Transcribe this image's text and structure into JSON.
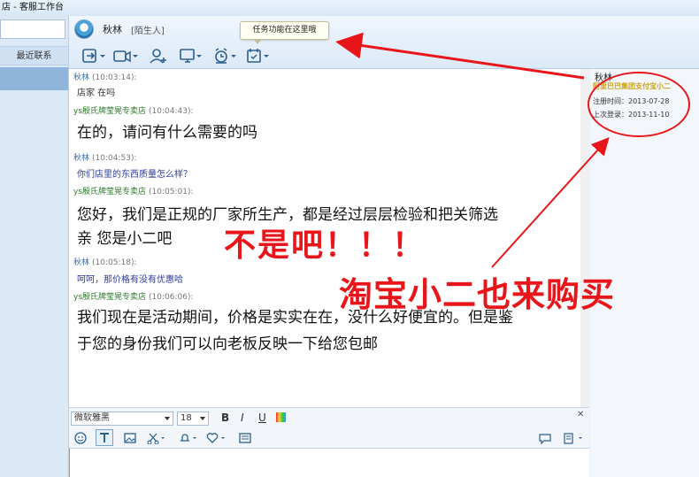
{
  "window": {
    "title": "店 - 客服工作台"
  },
  "left_panel": {
    "recent_label": "最近联系"
  },
  "header": {
    "contact_name": "秋林",
    "contact_tag": "[陌生人]",
    "tooltip": "任务功能在这里哦"
  },
  "toolbar_icons": [
    "transfer-icon",
    "video-icon",
    "add-contact-icon",
    "screen-share-icon",
    "alarm-icon",
    "task-icon"
  ],
  "messages": [
    {
      "sender": "秋林",
      "time": "(10:03:14):",
      "text": "店家 在吗",
      "role": "customer"
    },
    {
      "sender": "ys殷氏牌莹晃专卖店",
      "time": "(10:04:43):",
      "text": "在的，请问有什么需要的吗",
      "role": "seller"
    },
    {
      "sender": "秋林",
      "time": "(10:04:53):",
      "text": "你们店里的东西质量怎么样？",
      "role": "customer"
    },
    {
      "sender": "ys殷氏牌莹晃专卖店",
      "time": "(10:05:01):",
      "text": "您好，我们是正规的厂家所生产，都是经过层层检验和把关筛选",
      "text2": "亲 您是小二吧",
      "role": "seller"
    },
    {
      "sender": "秋林",
      "time": "(10:05:18):",
      "text": "呵呵，那价格有没有优惠哈",
      "role": "customer"
    },
    {
      "sender": "ys殷氏牌莹晃专卖店",
      "time": "(10:06:06):",
      "text": "我们现在是活动期间，价格是实实在在，没什么好便宜的。但是鉴",
      "text2": "于您的身份我们可以向老板反映一下给您包邮",
      "role": "seller"
    }
  ],
  "annotations": {
    "line1": "不是吧！！！",
    "line2": "淘宝小二也来购买",
    "color": "#e8161b"
  },
  "profile": {
    "name": "秋林",
    "company": "阿里巴巴集团支付宝小二",
    "register": "注册时间：2013-07-28",
    "last_login": "上次登录：2013-11-10"
  },
  "input": {
    "font": "微软雅黑",
    "size": "18",
    "bold": "B",
    "italic": "I",
    "underline": "U"
  }
}
